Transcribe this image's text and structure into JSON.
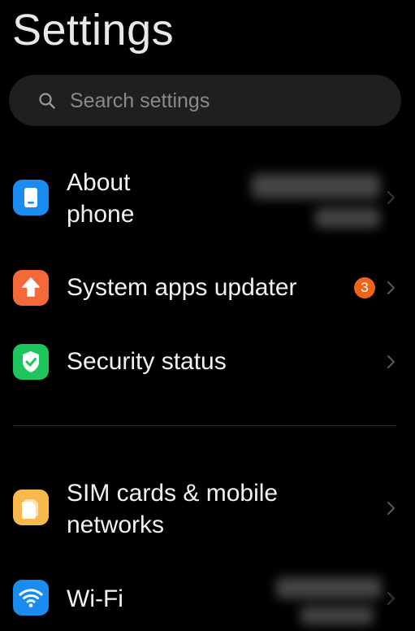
{
  "header": {
    "title": "Settings"
  },
  "search": {
    "placeholder": "Search settings",
    "icon": "search-icon"
  },
  "sections": [
    {
      "items": [
        {
          "label_lines": [
            "About",
            "phone"
          ],
          "icon": "phone-icon",
          "icon_color": "#1a8cf0",
          "secondary_value_redacted": true
        },
        {
          "label": "System apps updater",
          "icon": "arrow-up-icon",
          "icon_color": "#f4683a",
          "badge": "3",
          "badge_color": "#f06419"
        },
        {
          "label": "Security status",
          "icon": "shield-check-icon",
          "icon_color": "#1ec45c"
        }
      ]
    },
    {
      "items": [
        {
          "label_lines": [
            "SIM cards & mobile",
            "networks"
          ],
          "icon": "sim-card-icon",
          "icon_color": "#f7b94a"
        },
        {
          "label": "Wi-Fi",
          "icon": "wifi-icon",
          "icon_color": "#1a8cf0",
          "secondary_value_redacted": true
        }
      ]
    }
  ],
  "colors": {
    "background": "#000000",
    "search_bg": "#1f1f1f",
    "divider": "#2e2e2e",
    "chevron": "#5a5a5a"
  }
}
